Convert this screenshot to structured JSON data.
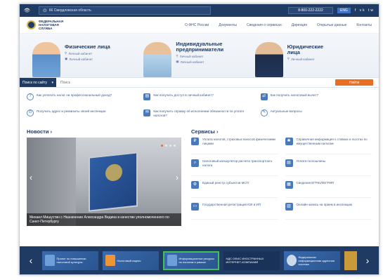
{
  "topbar": {
    "region": "66 Свердловская область",
    "phone": "8-800-222-2222",
    "badge": "ENG",
    "social": "f  vk  tw"
  },
  "header": {
    "logo_text": "ФЕДЕРАЛЬНАЯ НАЛОГОВАЯ СЛУЖБА",
    "menu": [
      "О ФНС России",
      "Документы",
      "Сведения о сервисах",
      "Дирекция",
      "Открытые данные",
      "Контакты"
    ]
  },
  "hero": [
    {
      "title": "Физические лица",
      "link1": "Личный кабинет",
      "link2": "Личный кабинет"
    },
    {
      "title": "Индивидуальные предприниматели",
      "link1": "Личный кабинет",
      "link2": "Личный кабинет"
    },
    {
      "title": "Юридические лица",
      "link1": "Личный кабинет",
      "link2": ""
    }
  ],
  "search": {
    "scope": "Поиск по сайту",
    "placeholder": "Поиск",
    "button": "Найти"
  },
  "quick_links": [
    "Как уплатить налог на профессиональный доход?",
    "Как получить доступ в личный кабинет?",
    "Как получить налоговый вычет?",
    "Получить адрес и реквизиты своей инспекции",
    "Как получить справку об исполнении обязанности по уплате налогов?",
    "Актуальные вопросы"
  ],
  "news": {
    "title": "Новости ›",
    "caption": "Михаил Мишустин с Назначение Александра Ведина в качестве уполномоченного по Санкт-Петербургу"
  },
  "services": {
    "title": "Сервисы ›",
    "items": [
      "Уплата налогов, страховых взносов физическими лицами",
      "Справочная информация о ставках и льготах по имущественным налогам",
      "Налоговый калькулятор расчета транспортного налога",
      "Уплата госпошлины",
      "Единый реестр субъектов МСП",
      "Сведения ЕГРЮЛ/ЕГРИП",
      "Государственная регистрация ЮЛ и ИП",
      "Онлайн-запись на прием в инспекцию"
    ]
  },
  "banners": [
    "Проект по повышению налоговой культуры",
    "Налоговый кодекс",
    "Информационные ресурсы по налогам в рамках",
    "НДС ОФИС ИНОСТРАННЫХ ИНТЕРНЕТ-КОМПАНИЙ",
    "Федеральная информационная адресная система",
    ""
  ]
}
